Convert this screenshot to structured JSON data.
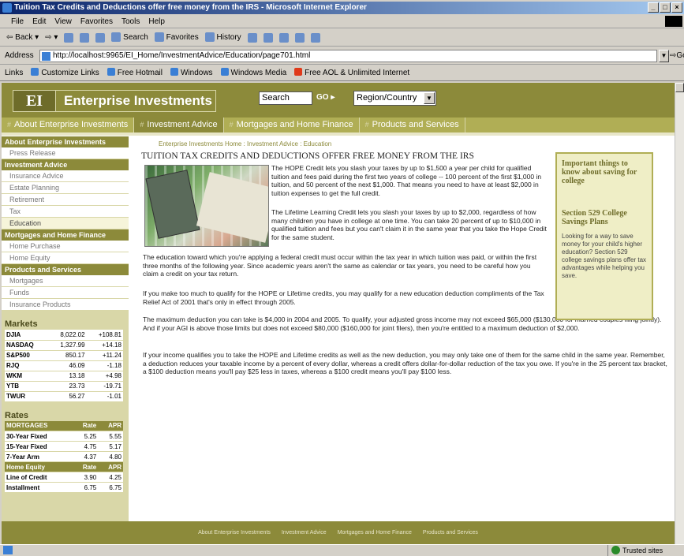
{
  "window": {
    "title": "Tuition Tax Credits and Deductions offer free money from the IRS - Microsoft Internet Explorer",
    "buttons": [
      "_",
      "□",
      "×"
    ]
  },
  "menu": [
    "File",
    "Edit",
    "View",
    "Favorites",
    "Tools",
    "Help"
  ],
  "toolbar": {
    "back": "⇦ Back ▾",
    "forward": "⇨ ▾",
    "search": "Search",
    "favorites": "Favorites",
    "history": "History"
  },
  "address": {
    "label": "Address",
    "url": "http://localhost:9965/EI_Home/InvestmentAdvice/Education/page701.html",
    "go": "Go"
  },
  "links": {
    "label": "Links",
    "items": [
      "Customize Links",
      "Free Hotmail",
      "Windows",
      "Windows Media",
      "Free AOL & Unlimited Internet"
    ]
  },
  "site": {
    "logo_mark": "EI",
    "logo_name": "Enterprise Investments",
    "search_label": "Search",
    "go_label": "GO ▸",
    "region_label": "Region/Country",
    "nav": [
      "About Enterprise Investments",
      "Investment Advice",
      "Mortgages and Home Finance",
      "Products and Services"
    ]
  },
  "sidebar": {
    "groups": [
      {
        "title": "About Enterprise Investments",
        "items": [
          "Press Release"
        ]
      },
      {
        "title": "Investment Advice",
        "items": [
          "Insurance Advice",
          "Estate Planning",
          "Retirement",
          "Tax",
          "Education"
        ]
      },
      {
        "title": "Mortgages and Home Finance",
        "items": [
          "Home Purchase",
          "Home Equity"
        ]
      },
      {
        "title": "Products and Services",
        "items": [
          "Mortgages",
          "Funds",
          "Insurance Products"
        ]
      }
    ],
    "markets_title": "Markets",
    "markets": [
      [
        "DJIA",
        "8,022.02",
        "+108.81"
      ],
      [
        "NASDAQ",
        "1,327.99",
        "+14.18"
      ],
      [
        "S&P500",
        "850.17",
        "+11.24"
      ],
      [
        "RJQ",
        "46.09",
        "-1.18"
      ],
      [
        "WKM",
        "13.18",
        "+4.98"
      ],
      [
        "YTB",
        "23.73",
        "-19.71"
      ],
      [
        "TWUR",
        "56.27",
        "-1.01"
      ]
    ],
    "rates_title": "Rates",
    "rates_header1": [
      "MORTGAGES",
      "Rate",
      "APR"
    ],
    "rates1": [
      [
        "30-Year Fixed",
        "5.25",
        "5.55"
      ],
      [
        "15-Year Fixed",
        "4.75",
        "5.17"
      ],
      [
        "7-Year Arm",
        "4.37",
        "4.80"
      ]
    ],
    "rates_header2": [
      "Home Equity",
      "Rate",
      "APR"
    ],
    "rates2": [
      [
        "Line of Credit",
        "3.90",
        "4.25"
      ],
      [
        "Installment",
        "6.75",
        "6.75"
      ]
    ]
  },
  "article": {
    "breadcrumb": "Enterprise Investments Home : Investment Advice : Education",
    "title": "TUITION TAX CREDITS AND DEDUCTIONS OFFER FREE MONEY FROM THE IRS",
    "p1": "The HOPE Credit lets you slash your taxes by up to $1,500 a year per child for qualified tuition and fees paid during the first two years of college -- 100 percent of the first $1,000 in tuition, and 50 percent of the next $1,000. That means you need to have at least $2,000 in tuition expenses to get the full credit.",
    "p2": "The Lifetime Learning Credit lets you slash your taxes by up to $2,000, regardless of how many children you have in college at one time. You can take 20 percent of up to $10,000 in qualified tuition and fees but you can't claim it in the same year that you take the Hope Credit for the same student.",
    "p3": "The education toward which you're applying a federal credit must occur within the tax year in which tuition was paid, or within the first three months of the following year. Since academic years aren't the same as calendar or tax years, you need to be careful how you claim a credit on your tax return.",
    "p4": "If you make too much to qualify for the HOPE or Lifetime credits, you may qualify for a new education deduction compliments of the Tax Relief Act of 2001 that's only in effect through 2005.",
    "p5": "The maximum deduction you can take is $4,000 in 2004 and 2005. To qualify, your adjusted gross income may not exceed $65,000 ($130,000 for married couples filing jointly). And if your AGI is above those limits but does not exceed $80,000 ($160,000 for joint filers), then you're entitled to a maximum deduction of $2,000.",
    "p6": "If your income qualifies you to take the HOPE and Lifetime credits as well as the new deduction, you may only take one of them for the same child in the same year. Remember, a deduction reduces your taxable income by a percent of every dollar, whereas a credit offers dollar-for-dollar reduction of the tax you owe. If you're in the 25 percent tax bracket, a $100 deduction means you'll pay $25 less in taxes, whereas a $100 credit means you'll pay $100 less."
  },
  "callout": {
    "heading": "Important things to know about saving for college",
    "subheading": "Section 529 College Savings Plans",
    "text": "Looking for a way to save money for your child's higher education? Section 529 college savings plans offer tax advantages while helping you save."
  },
  "footer": [
    "About Enterprise Investments",
    "Investment Advice",
    "Mortgages and Home Finance",
    "Products and Services"
  ],
  "status": {
    "zone": "Trusted sites"
  }
}
